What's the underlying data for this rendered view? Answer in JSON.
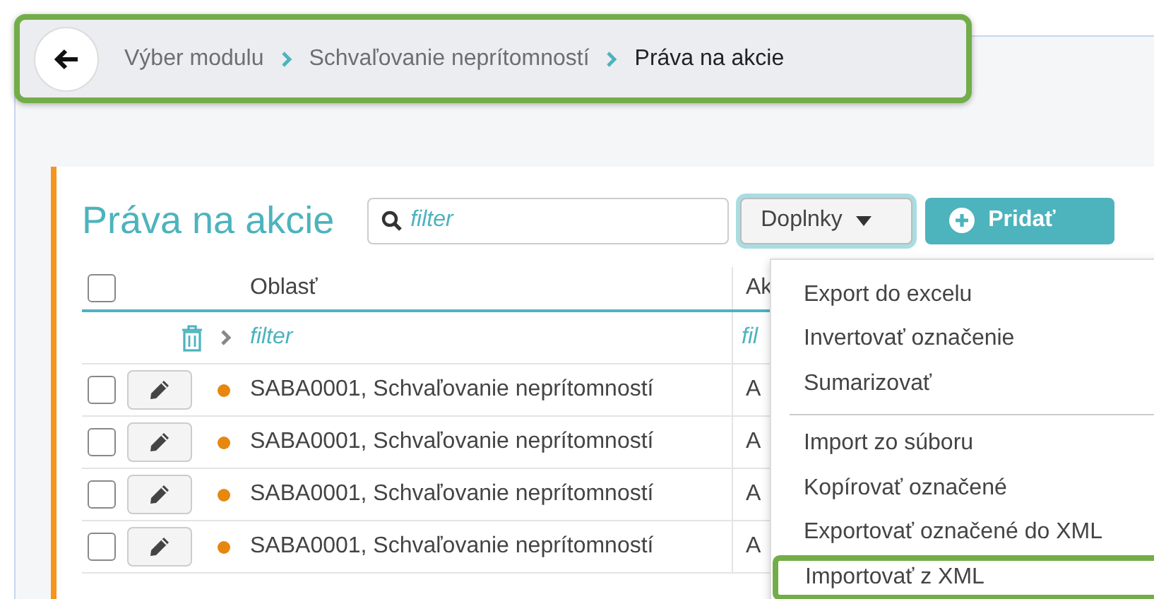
{
  "breadcrumb": {
    "highlighted": true,
    "items": [
      {
        "label": "Výber modulu",
        "current": false
      },
      {
        "label": "Schvaľovanie neprítomností",
        "current": false
      },
      {
        "label": "Práva na akcie",
        "current": true
      }
    ]
  },
  "panel": {
    "title": "Práva na akcie",
    "search": {
      "placeholder": "filter"
    },
    "buttons": [
      {
        "label": "Doplnky",
        "kind": "dropdown",
        "focused": true
      },
      {
        "label": "Pridať",
        "kind": "primary",
        "focused": false
      }
    ]
  },
  "table": {
    "all_checked": false,
    "columns": [
      "Oblasť",
      "Ak"
    ],
    "filter_placeholders": [
      "filter",
      "fil"
    ],
    "rows": [
      {
        "checked": false,
        "color": "#e8870e",
        "cells": [
          "SABA0001, Schvaľovanie neprítomností",
          "A"
        ]
      },
      {
        "checked": false,
        "color": "#e8870e",
        "cells": [
          "SABA0001, Schvaľovanie neprítomností",
          "A"
        ]
      },
      {
        "checked": false,
        "color": "#e8870e",
        "cells": [
          "SABA0001, Schvaľovanie neprítomností",
          "A"
        ]
      },
      {
        "checked": false,
        "color": "#e8870e",
        "cells": [
          "SABA0001, Schvaľovanie neprítomností",
          "A"
        ]
      }
    ]
  },
  "menu": {
    "items": [
      {
        "label": "Export do excelu",
        "separator_before": false,
        "highlighted": false
      },
      {
        "label": "Invertovať označenie",
        "separator_before": false,
        "highlighted": false
      },
      {
        "label": "Sumarizovať",
        "separator_before": false,
        "highlighted": false
      },
      {
        "label": "Import zo súboru",
        "separator_before": true,
        "highlighted": false
      },
      {
        "label": "Kopírovať označené",
        "separator_before": false,
        "highlighted": false
      },
      {
        "label": "Exportovať označené do XML",
        "separator_before": false,
        "highlighted": false
      },
      {
        "label": "Importovať z XML",
        "separator_before": false,
        "highlighted": true
      }
    ]
  }
}
